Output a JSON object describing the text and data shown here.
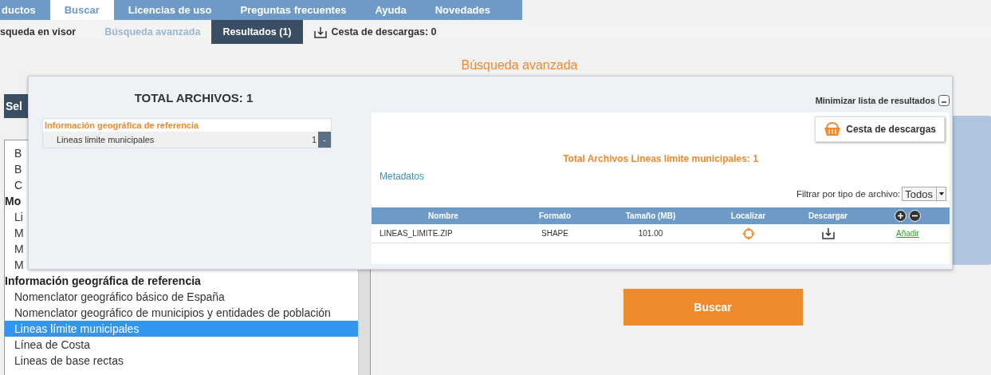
{
  "nav_tabs": [
    {
      "label": "ductos",
      "selected": false
    },
    {
      "label": "Buscar",
      "selected": true
    },
    {
      "label": "Licencias de uso",
      "selected": false
    },
    {
      "label": "Preguntas frecuentes",
      "selected": false
    },
    {
      "label": "Ayuda",
      "selected": false
    },
    {
      "label": "Novedades",
      "selected": false
    }
  ],
  "sub_tabs": [
    {
      "label": "squeda en visor",
      "kind": "tab",
      "selected": false
    },
    {
      "label": "Búsqueda avanzada",
      "kind": "link",
      "selected": false
    },
    {
      "label": "Resultados (1)",
      "kind": "tab",
      "selected": true
    },
    {
      "label": "Cesta de descargas: 0",
      "kind": "basket",
      "selected": false
    }
  ],
  "page_title": "Búsqueda avanzada",
  "left_panel": {
    "header": "Sel",
    "groups": [
      {
        "children": [
          {
            "label": "B",
            "selected": false
          },
          {
            "label": "B",
            "selected": false
          },
          {
            "label": "C",
            "selected": false
          }
        ]
      },
      {
        "label": "Mo",
        "children": [
          {
            "label": "Li",
            "selected": false
          },
          {
            "label": "M",
            "selected": false
          },
          {
            "label": "M",
            "selected": false
          },
          {
            "label": "M",
            "selected": false
          }
        ]
      },
      {
        "label": "Información geográfica de referencia",
        "children": [
          {
            "label": "Nomenclator geográfico básico de España",
            "selected": false
          },
          {
            "label": "Nomenclator geográfico de municipios y entidades de población",
            "selected": false
          },
          {
            "label": "Lineas límite municipales",
            "selected": true
          },
          {
            "label": "Línea de Costa",
            "selected": false
          },
          {
            "label": "Lineas de base rectas",
            "selected": false
          }
        ]
      }
    ]
  },
  "search_button": "Buscar",
  "results": {
    "total": "TOTAL ARCHIVOS: 1",
    "tree": {
      "label": "Información geográfica de referencia",
      "children": [
        {
          "label": "Lineas limite municipales",
          "count": "1",
          "button": "-"
        }
      ]
    },
    "minimize": "Minimizar lista de resultados",
    "basket_button": "Cesta de descargas",
    "summary": "Total Archivos Lineas límite municipales: 1",
    "metadata_link": "Metadatos",
    "filter": {
      "label": "Filtrar por tipo de archivo:",
      "value": "Todos"
    },
    "table": {
      "columns": [
        "Nombre",
        "Formato",
        "Tamaño (MB)",
        "Localizar",
        "Descargar"
      ],
      "rows": [
        {
          "name": "LINEAS_LIMITE.ZIP",
          "format": "SHAPE",
          "size": "101.00",
          "action": "Añadir"
        }
      ]
    }
  }
}
